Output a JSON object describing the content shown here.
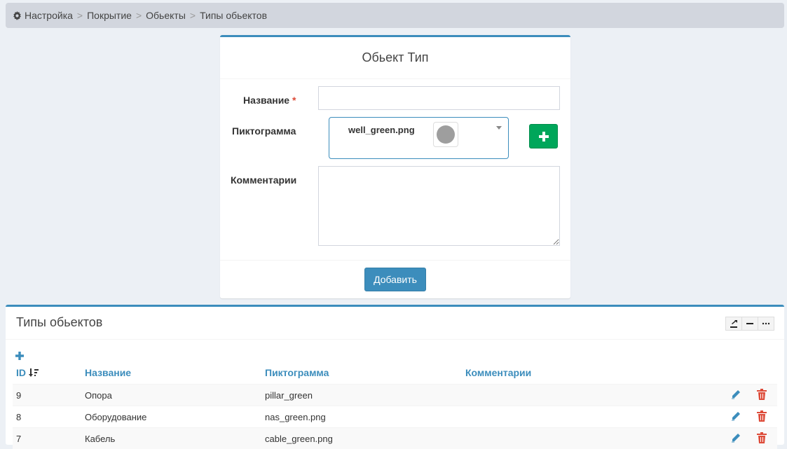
{
  "breadcrumb": [
    "Настройка",
    "Покрытие",
    "Обьекты",
    "Типы обьектов"
  ],
  "breadcrumb_sep": ">",
  "form": {
    "title": "Обьект Тип",
    "name_label": "Название",
    "required_mark": "*",
    "name_value": "",
    "icon_label": "Пиктограмма",
    "icon_selected": "well_green.png",
    "comment_label": "Комментарии",
    "comment_value": "",
    "submit_label": "Добавить",
    "add_icon": "plus-icon"
  },
  "list": {
    "title": "Типы обьектов",
    "columns": [
      "ID",
      "Название",
      "Пиктограмма",
      "Комментарии"
    ],
    "rows": [
      {
        "id": "9",
        "name": "Опора",
        "icon": "pillar_green",
        "comment": ""
      },
      {
        "id": "8",
        "name": "Оборудование",
        "icon": "nas_green.png",
        "comment": ""
      },
      {
        "id": "7",
        "name": "Кабель",
        "icon": "cable_green.png",
        "comment": ""
      }
    ]
  },
  "colors": {
    "accent": "#3c8dbc",
    "success": "#00a65a",
    "danger": "#dd4b39",
    "background": "#ecf0f5"
  }
}
